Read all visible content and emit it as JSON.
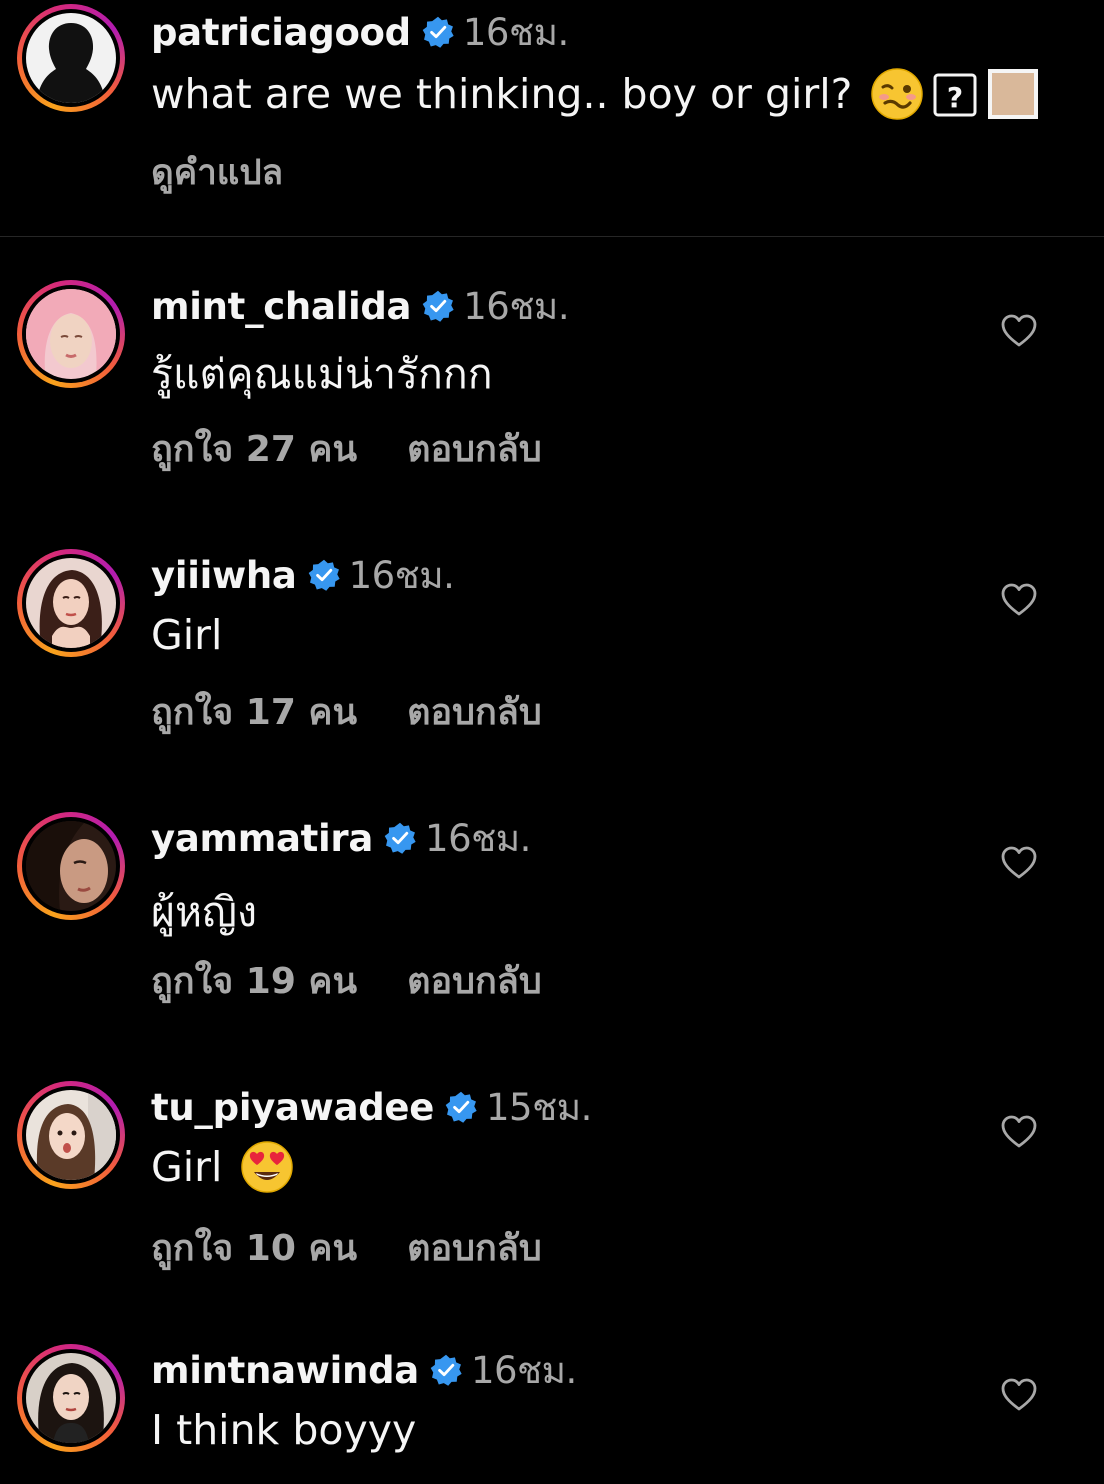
{
  "caption": {
    "username": "patriciagood",
    "time": "16ชม.",
    "text": "what are we thinking.. boy or girl?",
    "see_translation": "ดูคำแปล",
    "emoji_icons": [
      "woozy-face-icon",
      "question-box-icon",
      "skin-tone-swatch-icon"
    ],
    "accent": "#f9a21c"
  },
  "comments": [
    {
      "username": "mint_chalida",
      "time": "16ชม.",
      "text": "รู้แต่คุณแม่น่ารักกก",
      "likes": "ถูกใจ 27 คน",
      "reply": "ตอบกลับ",
      "avatar": "pink-hair-avatar"
    },
    {
      "username": "yiiiwha",
      "time": "16ชม.",
      "text": "Girl",
      "likes": "ถูกใจ 17 คน",
      "reply": "ตอบกลับ",
      "avatar": "woman-portrait-avatar"
    },
    {
      "username": "yammatira",
      "time": "16ชม.",
      "text": "ผู้หญิง",
      "likes": "ถูกใจ 19 คน",
      "reply": "ตอบกลับ",
      "avatar": "woman-closeup-avatar"
    },
    {
      "username": "tu_piyawadee",
      "time": "15ชม.",
      "text": "Girl",
      "likes": "ถูกใจ 10 คน",
      "reply": "ตอบกลับ",
      "avatar": "woman-selfie-avatar",
      "emoji": "heart-eyes-emoji-icon"
    },
    {
      "username": "mintnawinda",
      "time": "16ชม.",
      "text": "I think boyyy",
      "likes": "",
      "reply": "",
      "avatar": "woman-dark-hair-avatar"
    }
  ],
  "colors": {
    "background": "#000000",
    "text": "#f5f5f5",
    "secondary": "#a8a8a8",
    "verified": "#3797f0"
  }
}
